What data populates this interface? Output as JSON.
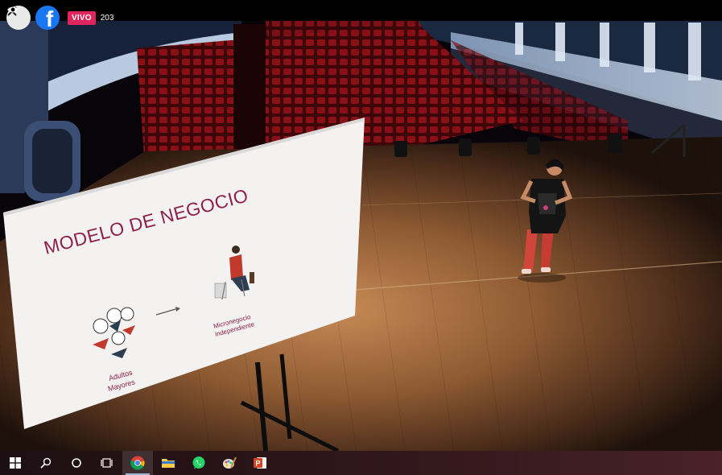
{
  "overlay": {
    "close_icon": "close-icon",
    "facebook_icon": "facebook-icon",
    "facebook_letter": "f",
    "live_label": "VIVO",
    "viewer_count": "203",
    "viewer_icon": "eye-icon"
  },
  "slide": {
    "title": "MODELO DE NEGOCIO",
    "left_caption_line1": "Adultos",
    "left_caption_line2": "Mayores",
    "right_caption_line1": "Micronegocio",
    "right_caption_line2": "independiente"
  },
  "taskbar": {
    "items": [
      {
        "name": "start",
        "icon": "windows-icon"
      },
      {
        "name": "search",
        "icon": "search-icon"
      },
      {
        "name": "cortana",
        "icon": "cortana-circle-icon"
      },
      {
        "name": "task-view",
        "icon": "task-view-icon"
      },
      {
        "name": "chrome",
        "icon": "chrome-icon",
        "active": true
      },
      {
        "name": "file-explorer",
        "icon": "folder-icon"
      },
      {
        "name": "whatsapp",
        "icon": "whatsapp-icon"
      },
      {
        "name": "paint",
        "icon": "paint-icon"
      },
      {
        "name": "powerpoint",
        "icon": "powerpoint-icon"
      }
    ]
  },
  "colors": {
    "live_badge": "#e0245e",
    "facebook": "#1877f2",
    "slide_title": "#8e1e4b",
    "seat_red": "#7a0c12",
    "stage_wood": "#8a5a34"
  }
}
